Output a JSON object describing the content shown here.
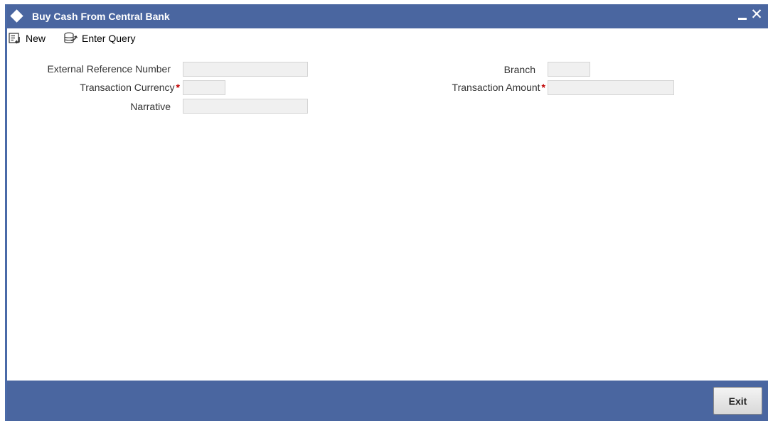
{
  "window": {
    "title": "Buy Cash From Central Bank",
    "close_glyph": "✕"
  },
  "toolbar": {
    "new_label": "New",
    "new_icon": "new-document-icon",
    "enter_query_label": "Enter Query",
    "enter_query_icon": "enter-query-icon"
  },
  "form": {
    "external_reference_number": {
      "label": "External Reference Number",
      "value": ""
    },
    "transaction_currency": {
      "label": "Transaction Currency",
      "required_mark": "*",
      "value": ""
    },
    "narrative": {
      "label": "Narrative",
      "value": ""
    },
    "branch": {
      "label": "Branch",
      "value": ""
    },
    "transaction_amount": {
      "label": "Transaction Amount",
      "required_mark": "*",
      "value": ""
    }
  },
  "footer": {
    "exit_label": "Exit"
  },
  "colors": {
    "titlebar": "#4a66a0",
    "footer": "#4a66a0",
    "required": "#c00000",
    "field_bg": "#f0f0f0"
  }
}
